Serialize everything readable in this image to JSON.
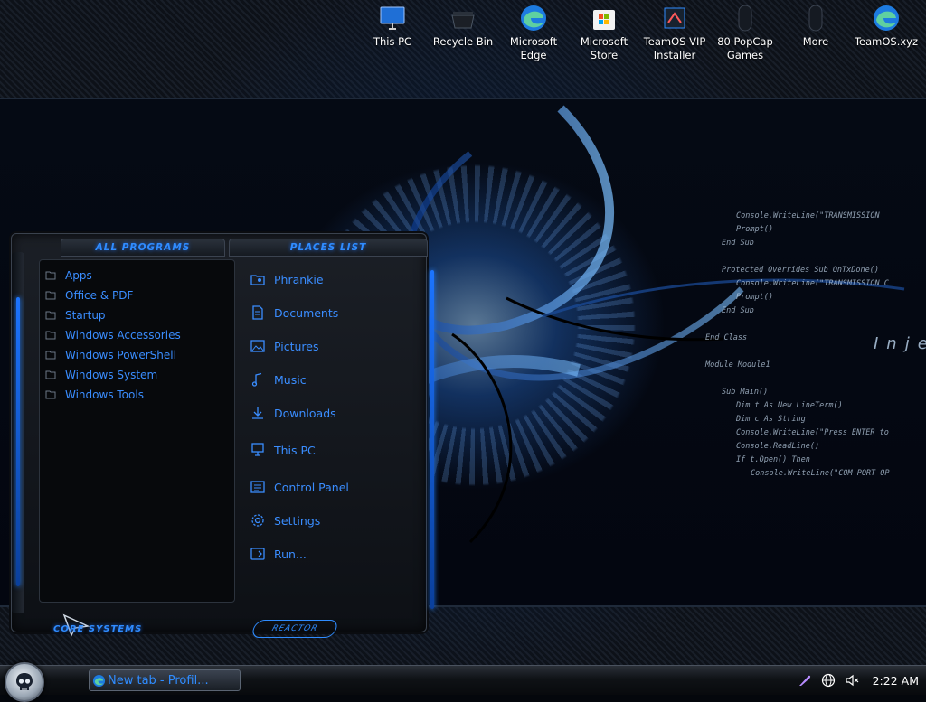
{
  "desktop": {
    "icons": [
      {
        "name": "this-pc",
        "label": "This PC",
        "icon": "monitor-icon"
      },
      {
        "name": "recycle-bin",
        "label": "Recycle Bin",
        "icon": "recycle-bin-icon"
      },
      {
        "name": "microsoft-edge",
        "label": "Microsoft Edge",
        "icon": "edge-icon"
      },
      {
        "name": "microsoft-store",
        "label": "Microsoft Store",
        "icon": "store-icon"
      },
      {
        "name": "teamos-vip-installer",
        "label": "TeamOS VIP Installer",
        "icon": "installer-icon"
      },
      {
        "name": "popcap-games",
        "label": "80 PopCap Games",
        "icon": "game-icon"
      },
      {
        "name": "more",
        "label": "More",
        "icon": "capsule-icon"
      },
      {
        "name": "teamos-xyz",
        "label": "TeamOS.xyz",
        "icon": "edge-icon"
      }
    ]
  },
  "wallpaper": {
    "code_lines": [
      "Console.WriteLine(\"TRANSMISSION",
      "Prompt()",
      "End Sub",
      "",
      "Protected Overrides Sub OnTxDone()",
      "Console.WriteLine(\"TRANSMISSION C",
      "Prompt()",
      "End Sub",
      "",
      "End Class",
      "",
      "Module Module1",
      "",
      "Sub Main()",
      "Dim t As New LineTerm()",
      "Dim c As String",
      "Console.WriteLine(\"Press ENTER to",
      "Console.ReadLine()",
      "If t.Open() Then",
      "Console.WriteLine(\"COM PORT OP"
    ],
    "inject_word": "Inje"
  },
  "start_menu": {
    "all_programs_header": "ALL PROGRAMS",
    "places_list_header": "PLACES LIST",
    "programs": [
      {
        "label": "Apps"
      },
      {
        "label": "Office & PDF"
      },
      {
        "label": "Startup"
      },
      {
        "label": "Windows Accessories"
      },
      {
        "label": "Windows PowerShell"
      },
      {
        "label": "Windows System"
      },
      {
        "label": "Windows Tools"
      }
    ],
    "places": [
      {
        "name": "phrankie",
        "label": "Phrankie",
        "icon": "user-folder-icon"
      },
      {
        "name": "documents",
        "label": "Documents",
        "icon": "document-icon"
      },
      {
        "name": "pictures",
        "label": "Pictures",
        "icon": "picture-icon"
      },
      {
        "name": "music",
        "label": "Music",
        "icon": "music-note-icon"
      },
      {
        "name": "downloads",
        "label": "Downloads",
        "icon": "download-arrow-icon"
      },
      {
        "name": "this-pc",
        "label": "This PC",
        "icon": "computer-icon"
      },
      {
        "name": "control-panel",
        "label": "Control Panel",
        "icon": "control-panel-icon"
      },
      {
        "name": "settings",
        "label": "Settings",
        "icon": "gear-icon"
      },
      {
        "name": "run",
        "label": "Run...",
        "icon": "run-icon"
      }
    ],
    "brand_left": "CORE SYSTEMS",
    "brand_right": "REACTOR"
  },
  "taskbar": {
    "active_window": "New tab - Profil...",
    "clock": "2:22 AM"
  },
  "colors": {
    "accent": "#2f8cff",
    "rail": "#1c74ff",
    "panel": "#07090c"
  }
}
